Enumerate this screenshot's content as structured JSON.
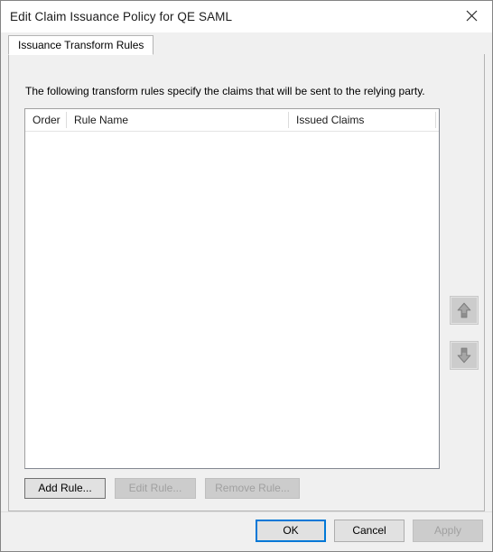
{
  "window": {
    "title": "Edit Claim Issuance Policy for QE SAML",
    "close_icon": "close-icon"
  },
  "tabs": [
    {
      "label": "Issuance Transform Rules",
      "selected": true
    }
  ],
  "panel": {
    "description": "The following transform rules specify the claims that will be sent to the relying party."
  },
  "rules_list": {
    "columns": [
      {
        "label": "Order"
      },
      {
        "label": "Rule Name"
      },
      {
        "label": "Issued Claims"
      }
    ],
    "rows": []
  },
  "move_buttons": {
    "up": {
      "icon": "arrow-up-icon",
      "enabled": false
    },
    "down": {
      "icon": "arrow-down-icon",
      "enabled": false
    }
  },
  "rule_actions": {
    "add": {
      "label": "Add Rule...",
      "enabled": true
    },
    "edit": {
      "label": "Edit Rule...",
      "enabled": false
    },
    "remove": {
      "label": "Remove Rule...",
      "enabled": false
    }
  },
  "dialog_buttons": {
    "ok": {
      "label": "OK",
      "enabled": true,
      "focused": true
    },
    "cancel": {
      "label": "Cancel",
      "enabled": true,
      "focused": false
    },
    "apply": {
      "label": "Apply",
      "enabled": false,
      "focused": false
    }
  },
  "colors": {
    "accent": "#0078d7",
    "dialog_bg": "#f0f0f0",
    "field_bg": "#ffffff",
    "button_bg": "#e1e1e1",
    "disabled_text": "#a0a0a0",
    "border": "#adadad"
  }
}
